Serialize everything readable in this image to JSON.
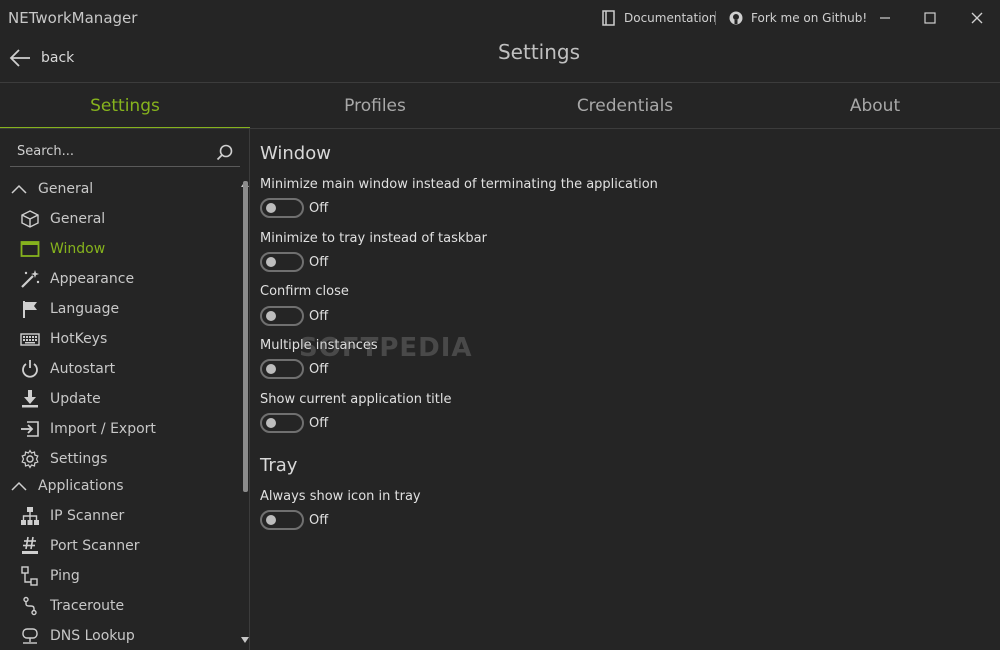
{
  "window": {
    "app_title": "NETworkManager",
    "documentation_label": "Documentation",
    "github_label": "Fork me on Github!"
  },
  "header": {
    "back_label": "back",
    "title": "Settings"
  },
  "tabs": [
    {
      "label": "Settings",
      "active": true
    },
    {
      "label": "Profiles",
      "active": false
    },
    {
      "label": "Credentials",
      "active": false
    },
    {
      "label": "About",
      "active": false
    }
  ],
  "sidebar": {
    "search_placeholder": "Search...",
    "groups": [
      {
        "label": "General",
        "expanded": true
      },
      {
        "label": "Applications",
        "expanded": true
      }
    ],
    "general_items": [
      {
        "label": "General",
        "icon": "cube-icon"
      },
      {
        "label": "Window",
        "icon": "window-icon",
        "active": true
      },
      {
        "label": "Appearance",
        "icon": "magic-wand-icon"
      },
      {
        "label": "Language",
        "icon": "flag-icon"
      },
      {
        "label": "HotKeys",
        "icon": "keyboard-icon"
      },
      {
        "label": "Autostart",
        "icon": "power-icon"
      },
      {
        "label": "Update",
        "icon": "download-icon"
      },
      {
        "label": "Import / Export",
        "icon": "import-icon"
      },
      {
        "label": "Settings",
        "icon": "gear-icon"
      }
    ],
    "application_items": [
      {
        "label": "IP Scanner",
        "icon": "network-tree-icon"
      },
      {
        "label": "Port Scanner",
        "icon": "hash-icon"
      },
      {
        "label": "Ping",
        "icon": "ping-icon"
      },
      {
        "label": "Traceroute",
        "icon": "route-icon"
      },
      {
        "label": "DNS Lookup",
        "icon": "dns-icon"
      }
    ]
  },
  "content": {
    "sections": [
      {
        "title": "Window",
        "options": [
          {
            "label": "Minimize main window instead of terminating the application",
            "state": "Off"
          },
          {
            "label": "Minimize to tray instead of taskbar",
            "state": "Off"
          },
          {
            "label": "Confirm close",
            "state": "Off"
          },
          {
            "label": "Multiple instances",
            "state": "Off"
          },
          {
            "label": "Show current application title",
            "state": "Off"
          }
        ]
      },
      {
        "title": "Tray",
        "options": [
          {
            "label": "Always show icon in tray",
            "state": "Off"
          }
        ]
      }
    ]
  },
  "watermark": "SOFTPEDIA",
  "colors": {
    "accent": "#86b31d",
    "background": "#252525",
    "text": "#d8d8d8"
  }
}
